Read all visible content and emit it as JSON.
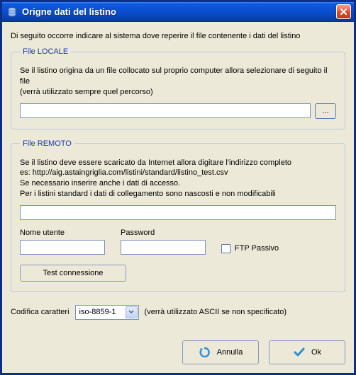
{
  "window": {
    "title": "Origne dati del listino"
  },
  "intro": "Di seguito occorre indicare al sistema dove reperire il file contenente i dati del listino",
  "local": {
    "legend": "File LOCALE",
    "desc1": "Se il listino origina da un file collocato sul proprio computer allora selezionare di seguito il file",
    "desc2": "(verrà utilizzato sempre quel percorso)",
    "path_value": "",
    "browse_label": "..."
  },
  "remote": {
    "legend": "File REMOTO",
    "desc1": "Se il listino deve essere scaricato da Internet allora digitare l'indirizzo completo",
    "desc2": "es: http://aig.astaingriglia.com/listini/standard/listino_test.csv",
    "desc3": "Se necessario inserire anche i dati di accesso.",
    "desc4": "Per i listini standard i dati di collegamento sono nascosti e non modificabili",
    "url_value": "",
    "username_label": "Nome utente",
    "username_value": "",
    "password_label": "Password",
    "password_value": "",
    "ftp_passive_label": "FTP Passivo",
    "test_label": "Test connessione"
  },
  "encoding": {
    "label": "Codifica caratteri",
    "selected": "iso-8859-1",
    "hint": "(verrà utilizzato ASCII se non specificato)"
  },
  "footer": {
    "cancel": "Annulla",
    "ok": "Ok"
  },
  "icons": {
    "database": "database-icon",
    "close": "close-icon",
    "cancel": "cancel-arrow-icon",
    "ok": "check-icon",
    "dropdown": "chevron-down-icon"
  }
}
